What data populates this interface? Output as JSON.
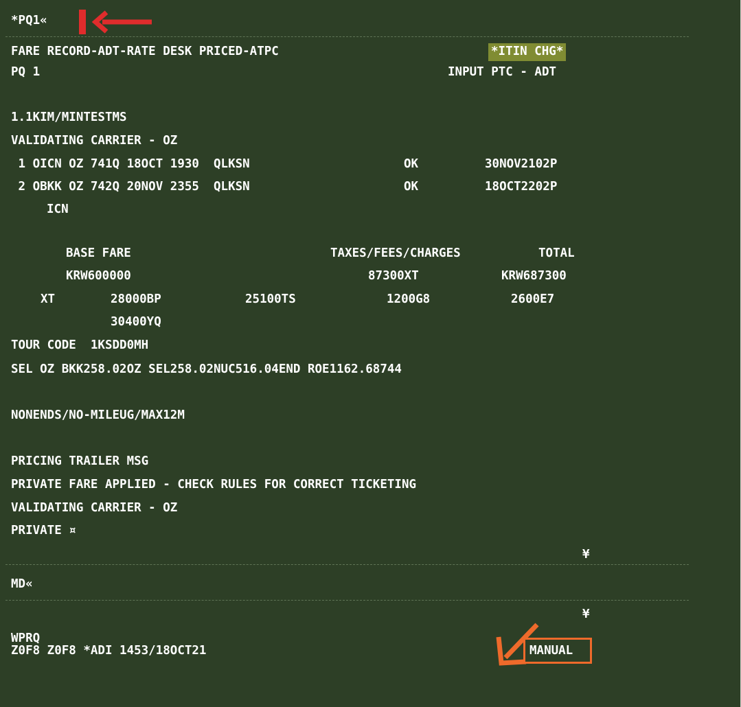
{
  "screen": {
    "lines": [
      "*PQ1«",
      "FARE RECORD-ADT-RATE DESK PRICED-ATPC",
      "*ITIN CHG*",
      "PQ 1",
      "INPUT PTC - ADT",
      "1.1KIM/MINTESTMS",
      "VALIDATING CARRIER - OZ",
      " 1 OICN OZ 741Q 18OCT 1930  QLKSN",
      "OK",
      "30NOV2102P",
      " 2 OBKK OZ 742Q 20NOV 2355  QLKSN",
      "OK",
      "18OCT2202P",
      "ICN",
      "BASE FARE",
      "TAXES/FEES/CHARGES",
      "TOTAL",
      "KRW600000",
      "87300XT",
      "KRW687300",
      "XT",
      "28000BP",
      "25100TS",
      "1200G8",
      "2600E7",
      "30400YQ",
      "TOUR CODE  1KSDD0MH",
      "SEL OZ BKK258.02OZ SEL258.02NUC516.04END ROE1162.68744",
      "NONENDS/NO-MILEUG/MAX12M",
      "PRICING TRAILER MSG",
      "PRIVATE FARE APPLIED - CHECK RULES FOR CORRECT TICKETING",
      "VALIDATING CARRIER - OZ",
      "PRIVATE ¤",
      "¥",
      "MD«",
      "¥",
      "WPRQ",
      "Z0F8 Z0F8 *ADI 1453/18OCT21",
      "MANUAL"
    ]
  },
  "annotations": {
    "top_marker_icon": "red-arrow-left-icon",
    "bottom_marker_icon": "orange-arrow-down-left-icon",
    "red_color": "#e02c2c",
    "orange_color": "#ee6a2b"
  },
  "colors": {
    "terminal_background": "#2d3f26",
    "terminal_text": "#ffffff",
    "highlight_background": "#808c33"
  }
}
